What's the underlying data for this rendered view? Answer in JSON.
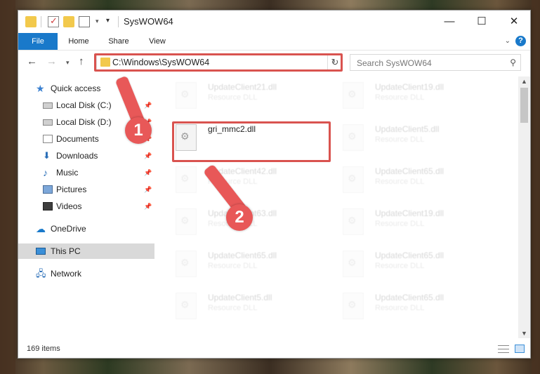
{
  "window": {
    "title": "SysWOW64",
    "controls": {
      "minimize": "—",
      "maximize": "☐",
      "close": "✕"
    }
  },
  "ribbon": {
    "tabs": [
      "File",
      "Home",
      "Share",
      "View"
    ],
    "help": "?"
  },
  "navigation": {
    "address": "C:\\Windows\\SysWOW64",
    "search_placeholder": "Search SysWOW64"
  },
  "sidebar": {
    "items": [
      {
        "label": "Quick access",
        "icon": "star-icon"
      },
      {
        "label": "Local Disk (C:)",
        "icon": "disk-icon",
        "pinned": true
      },
      {
        "label": "Local Disk (D:)",
        "icon": "disk-icon",
        "pinned": true
      },
      {
        "label": "Documents",
        "icon": "documents-icon",
        "pinned": true
      },
      {
        "label": "Downloads",
        "icon": "downloads-icon",
        "pinned": true
      },
      {
        "label": "Music",
        "icon": "music-icon",
        "pinned": true
      },
      {
        "label": "Pictures",
        "icon": "pictures-icon",
        "pinned": true
      },
      {
        "label": "Videos",
        "icon": "videos-icon",
        "pinned": true
      },
      {
        "label": "OneDrive",
        "icon": "cloud-icon"
      },
      {
        "label": "This PC",
        "icon": "pc-icon",
        "selected": true
      },
      {
        "label": "Network",
        "icon": "network-icon"
      }
    ]
  },
  "files": {
    "highlighted": {
      "name": "gri_mmc2.dll"
    },
    "left_column": [
      {
        "name": "UpdateClient21.dll",
        "type": "Resource DLL"
      },
      {
        "name": "UpdateClient42.dll",
        "type": "Resource DLL"
      },
      {
        "name": "UpdateClient63.dll",
        "type": "Resource DLL"
      },
      {
        "name": "UpdateClient65.dll",
        "type": "Resource DLL"
      },
      {
        "name": "UpdateClient5.dll",
        "type": "Resource DLL"
      }
    ],
    "right_column": [
      {
        "name": "UpdateClient19.dll",
        "type": "Resource DLL"
      },
      {
        "name": "UpdateClient5.dll",
        "type": "Resource DLL"
      },
      {
        "name": "UpdateClient65.dll",
        "type": "Resource DLL"
      },
      {
        "name": "UpdateClient19.dll",
        "type": "Resource DLL"
      },
      {
        "name": "UpdateClient65.dll",
        "type": "Resource DLL"
      },
      {
        "name": "UpdateClient65.dll",
        "type": "Resource DLL"
      }
    ]
  },
  "status": {
    "item_count": "169 items"
  },
  "annotations": {
    "step1": "1",
    "step2": "2",
    "color": "#e85858",
    "highlight_color": "#d9534f"
  }
}
